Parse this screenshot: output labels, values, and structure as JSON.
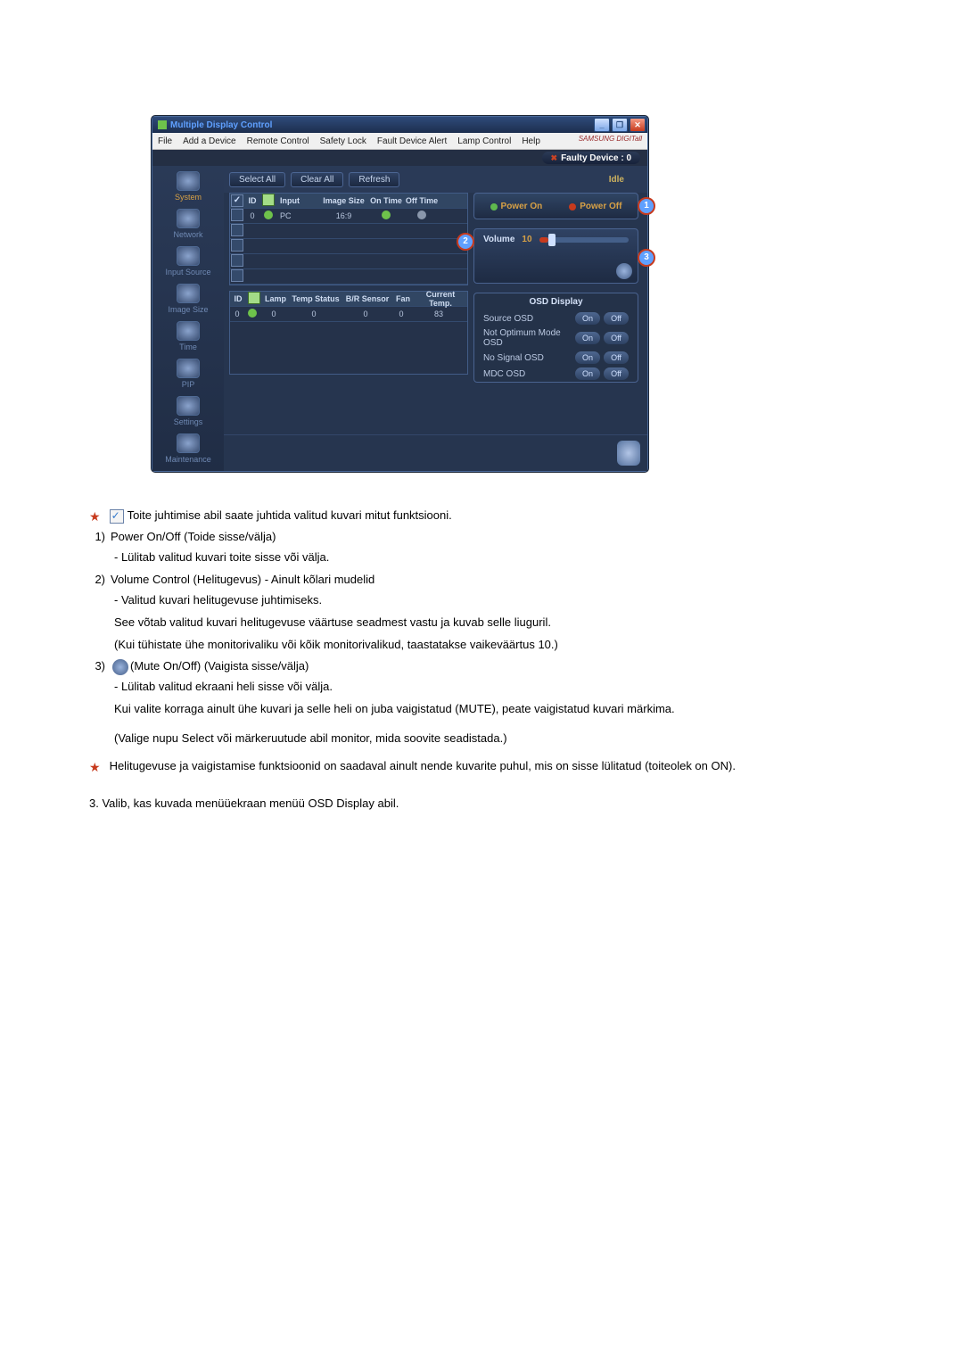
{
  "window": {
    "title": "Multiple Display Control",
    "min": "_",
    "max": "❐",
    "close": "✕"
  },
  "menu": {
    "file": "File",
    "add": "Add a Device",
    "remote": "Remote Control",
    "safety": "Safety Lock",
    "fault": "Fault Device Alert",
    "lamp": "Lamp Control",
    "help": "Help",
    "brand": "SAMSUNG DIGITall"
  },
  "fault_badge": "Faulty Device : 0",
  "side": {
    "system": "System",
    "network": "Network",
    "input": "Input Source",
    "image": "Image Size",
    "time": "Time",
    "pip": "PIP",
    "settings": "Settings",
    "maint": "Maintenance"
  },
  "toolbar": {
    "select_all": "Select All",
    "clear_all": "Clear All",
    "refresh": "Refresh",
    "idle": "Idle"
  },
  "table1": {
    "h_id": "ID",
    "h_input": "Input",
    "h_imgsize": "Image Size",
    "h_ontime": "On Time",
    "h_offtime": "Off Time",
    "r_id": "0",
    "r_input": "PC",
    "r_imgsize": "16:9"
  },
  "table2": {
    "h_id": "ID",
    "h_lamp": "Lamp",
    "h_temp": "Temp Status",
    "h_br": "B/R Sensor",
    "h_fan": "Fan",
    "h_ct": "Current Temp.",
    "r_id": "0",
    "r_lamp": "0",
    "r_temp": "0",
    "r_br": "0",
    "r_fan": "0",
    "r_ct": "83"
  },
  "power": {
    "on": "Power On",
    "off": "Power Off"
  },
  "callouts": {
    "c1": "1",
    "c2": "2",
    "c3": "3"
  },
  "volume": {
    "label": "Volume",
    "value": "10"
  },
  "osd": {
    "head": "OSD Display",
    "row1": "Source OSD",
    "row2": "Not Optimum Mode OSD",
    "row3": "No Signal OSD",
    "row4": "MDC OSD",
    "on": "On",
    "off": "Off"
  },
  "doc": {
    "intro": "Toite juhtimise abil saate juhtida valitud kuvari mitut funktsiooni.",
    "n1": "1)",
    "t1": "Power On/Off (Toide sisse/välja)",
    "t1a": "- Lülitab valitud kuvari toite sisse või välja.",
    "n2": "2)",
    "t2": "Volume Control (Helitugevus) - Ainult kõlari mudelid",
    "t2a": "- Valitud kuvari helitugevuse juhtimiseks.",
    "t2b": "See võtab valitud kuvari helitugevuse väärtuse seadmest vastu ja kuvab selle liuguril.",
    "t2c": "(Kui tühistate ühe monitorivaliku või kõik monitorivalikud, taastatakse vaikeväärtus 10.)",
    "n3": "3)",
    "t3": "(Mute On/Off) (Vaigista sisse/välja)",
    "t3a": "- Lülitab valitud ekraani heli sisse või välja.",
    "t3b": "Kui valite korraga ainult ühe kuvari ja selle heli on juba vaigistatud (MUTE), peate vaigistatud kuvari märkima.",
    "t3c": "(Valige nupu Select või märkeruutude abil monitor, mida soovite seadistada.)",
    "note": "Helitugevuse ja vaigistamise funktsioonid on saadaval ainult nende kuvarite puhul, mis on sisse lülitatud (toiteolek on ON).",
    "final": "3. Valib, kas kuvada menüüekraan menüü OSD Display abil."
  }
}
